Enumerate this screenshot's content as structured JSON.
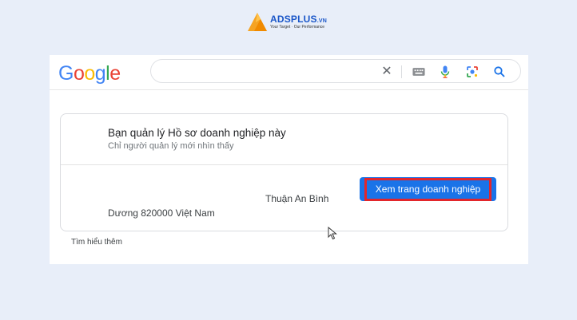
{
  "brand": {
    "name": "ADSPLUS",
    "suffix": ".VN",
    "tagline": "Your Target · Our Performance",
    "colors": {
      "orange": "#f5a323",
      "blue": "#1a56c8"
    }
  },
  "google": {
    "logo_letters": [
      {
        "ch": "G",
        "color": "#4285f4"
      },
      {
        "ch": "o",
        "color": "#ea4335"
      },
      {
        "ch": "o",
        "color": "#fbbc05"
      },
      {
        "ch": "g",
        "color": "#4285f4"
      },
      {
        "ch": "l",
        "color": "#34a853"
      },
      {
        "ch": "e",
        "color": "#ea4335"
      }
    ],
    "search": {
      "value": "",
      "icons": [
        "close-icon",
        "keyboard-icon",
        "microphone-icon",
        "lens-icon",
        "search-icon"
      ]
    }
  },
  "business_card": {
    "title": "Bạn quản lý Hồ sơ doanh nghiệp này",
    "subtitle": "Chỉ người quản lý mới nhìn thấy",
    "view_button_label": "Xem trang doanh nghiệp",
    "address_line1": "Thuận An Bình",
    "address_line2": "Dương 820000 Việt Nam",
    "highlight_color": "#e3262b"
  },
  "learn_more": "Tìm hiểu thêm"
}
